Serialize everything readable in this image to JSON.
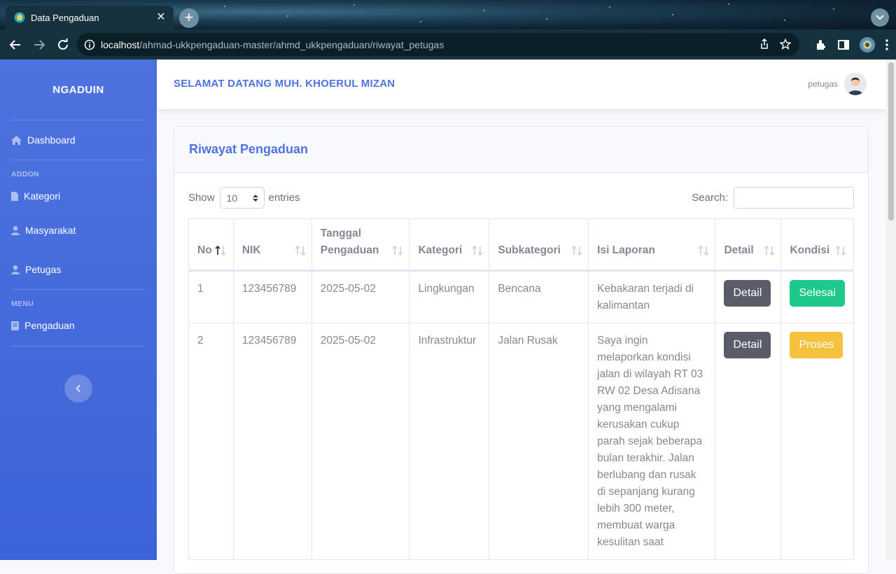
{
  "browser": {
    "tab_title": "Data Pengaduan",
    "url_host": "localhost",
    "url_path": "/ahmad-ukkpengaduan-master/ahmd_ukkpengaduan/riwayat_petugas"
  },
  "sidebar": {
    "brand": "NGADUIN",
    "dashboard": "Dashboard",
    "heading_addon": "ADDON",
    "kategori": "Kategori",
    "masyarakat": "Masyarakat",
    "petugas": "Petugas",
    "heading_menu": "MENU",
    "pengaduan": "Pengaduan"
  },
  "topbar": {
    "welcome": "SELAMAT DATANG MUH. KHOERUL MIZAN",
    "username": "petugas"
  },
  "card": {
    "title": "Riwayat Pengaduan",
    "show_label": "Show",
    "entries_value": "10",
    "entries_label": "entries",
    "search_label": "Search:"
  },
  "table": {
    "headers": [
      "No",
      "NIK",
      "Tanggal Pengaduan",
      "Kategori",
      "Subkategori",
      "Isi Laporan",
      "Detail",
      "Kondisi"
    ],
    "rows": [
      {
        "no": "1",
        "nik": "123456789",
        "tanggal": "2025-05-02",
        "kategori": "Lingkungan",
        "subkategori": "Bencana",
        "isi": "Kebakaran terjadi di kalimantan",
        "detail": "Detail",
        "kondisi": "Selesai"
      },
      {
        "no": "2",
        "nik": "123456789",
        "tanggal": "2025-05-02",
        "kategori": "Infrastruktur",
        "subkategori": "Jalan Rusak",
        "isi": "Saya ingin melaporkan kondisi jalan di wilayah RT 03 RW 02 Desa Adisana yang mengalami kerusakan cukup parah sejak beberapa bulan terakhir. Jalan berlubang dan rusak di sepanjang kurang lebih 300 meter, membuat warga kesulitan saat",
        "detail": "Detail",
        "kondisi": "Proses"
      }
    ]
  },
  "colors": {
    "primary": "#4e73df",
    "success": "#1cc88a",
    "warning": "#f6c23e",
    "secondary": "#5a5c69"
  }
}
